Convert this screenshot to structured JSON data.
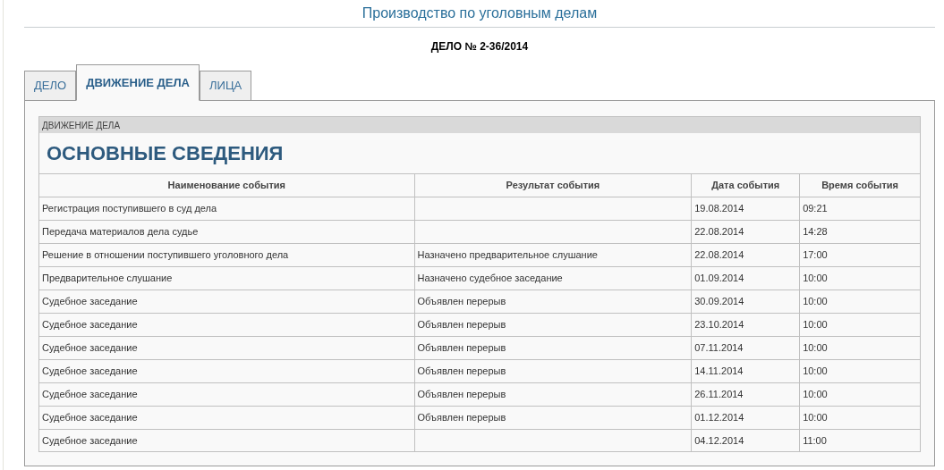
{
  "page_title": "Производство по уголовным делам",
  "case_title": "ДЕЛО № 2-36/2014",
  "tabs": [
    {
      "label": "ДЕЛО",
      "selected": false
    },
    {
      "label": "ДВИЖЕНИЕ ДЕЛА",
      "selected": true
    },
    {
      "label": "ЛИЦА",
      "selected": false
    }
  ],
  "section": {
    "caption": "ДВИЖЕНИЕ ДЕЛА",
    "heading": "ОСНОВНЫЕ СВЕДЕНИЯ"
  },
  "table": {
    "columns": [
      "Наименование события",
      "Результат события",
      "Дата события",
      "Время события"
    ],
    "rows": [
      {
        "event": "Регистрация поступившего в суд дела",
        "date": "19.08.2014",
        "time": "09:21"
      },
      {
        "event": "Передача материалов дела судье",
        "date": "22.08.2014",
        "time": "14:28"
      },
      {
        "event": "Решение в отношении поступившего уголовного дела",
        "result": "Назначено предварительное слушание",
        "date": "22.08.2014",
        "time": "17:00"
      },
      {
        "event": "Предварительное слушание",
        "result": "Назначено судебное заседание",
        "date": "01.09.2014",
        "time": "10:00"
      },
      {
        "event": "Судебное заседание",
        "result": "Объявлен перерыв",
        "date": "30.09.2014",
        "time": "10:00"
      },
      {
        "event": "Судебное заседание",
        "result": "Объявлен перерыв",
        "date": "23.10.2014",
        "time": "10:00"
      },
      {
        "event": "Судебное заседание",
        "result": "Объявлен перерыв",
        "date": "07.11.2014",
        "time": "10:00"
      },
      {
        "event": "Судебное заседание",
        "result": "Объявлен перерыв",
        "date": "14.11.2014",
        "time": "10:00"
      },
      {
        "event": "Судебное заседание",
        "result": "Объявлен перерыв",
        "date": "26.11.2014",
        "time": "10:00"
      },
      {
        "event": "Судебное заседание",
        "result": "Объявлен перерыв",
        "date": "01.12.2014",
        "time": "10:00"
      },
      {
        "event": "Судебное заседание",
        "date": "04.12.2014",
        "time": "11:00"
      }
    ]
  }
}
